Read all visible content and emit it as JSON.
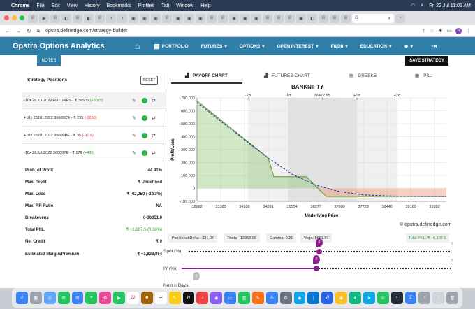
{
  "menubar": {
    "app": "Chrome",
    "items": [
      "File",
      "Edit",
      "View",
      "History",
      "Bookmarks",
      "Profiles",
      "Tab",
      "Window",
      "Help"
    ],
    "datetime": "Fri 22 Jul  11:05 AM"
  },
  "browser": {
    "url": "opstra.definedge.com/strategy-builder",
    "active_tab_icon": "G"
  },
  "app": {
    "brand": "Opstra Options Analytics",
    "nav": [
      "PORTFOLIO",
      "FUTURES",
      "OPTIONS",
      "OPEN INTEREST",
      "FII/DII",
      "EDUCATION"
    ],
    "notes": "NOTES",
    "save_strategy": "SAVE STRATEGY"
  },
  "positions": {
    "title": "Strategy Positions",
    "reset": "RESET",
    "items": [
      {
        "desc": "-10x  28JUL2022  FUTURES  - ₹ 36505",
        "chg": "(+9025)",
        "dir": "pos"
      },
      {
        "desc": "+10x  28JUL2022  36600CE  - ₹ 295",
        "chg": "(-3250)",
        "dir": "neg"
      },
      {
        "desc": "+10x  28JUL2022  35000PE  - ₹ 35",
        "chg": "(-37.5)",
        "dir": "neg"
      },
      {
        "desc": "-10x  28JUL2022  36000PE  - ₹ 176",
        "chg": "(+430)",
        "dir": "pos"
      }
    ]
  },
  "stats": [
    {
      "label": "Prob. of Profit",
      "value": "44.91%"
    },
    {
      "label": "Max. Profit",
      "value": "₹ Undefined"
    },
    {
      "label": "Max. Loss",
      "value": "₹ -62,250 (-3.83%)"
    },
    {
      "label": "Max. RR Ratio",
      "value": "NA"
    },
    {
      "label": "Breakevens",
      "value": "0-36351.0"
    },
    {
      "label": "Total PNL",
      "value": "₹ +6,187.5 (0.38%)"
    },
    {
      "label": "Net Credit",
      "value": "₹ 0"
    },
    {
      "label": "Estimated Margin/Premium",
      "value": "₹ +1,623,864"
    }
  ],
  "chart_tabs": [
    "PAYOFF CHART",
    "FUTURES CHART",
    "GREEKS",
    "P&L"
  ],
  "greeks": {
    "delta": "Positional Delta: -331.07",
    "theta": "Theta: -13953.98",
    "gamma": "Gamma: 0.21",
    "vega": "Vega: 8661.97",
    "total_pnl": "Total PNL: ₹ +6,187.5"
  },
  "sliders": {
    "spot_label": "Spot (%):",
    "iv_label": "IV (%):",
    "days_label": "Next n Days:",
    "spot_value": "0",
    "iv_value": "0",
    "days_value": "0"
  },
  "watermark": "© opstra.definedge.com",
  "colors": {
    "nav": "#2e7ea8",
    "profit": "#2a9d2a",
    "loss": "#e04040"
  },
  "chart_data": {
    "type": "area",
    "title": "BANKNIFTY",
    "xlabel": "Underlying Price",
    "ylabel": "Profit/Loss",
    "xlim": [
      32662,
      40250
    ],
    "ylim": [
      -100000,
      700000
    ],
    "x_ticks": [
      32662,
      33385,
      34108,
      34831,
      35554,
      36277,
      37000,
      37723,
      38446,
      39169,
      39892
    ],
    "y_ticks": [
      -100000,
      0,
      100000,
      200000,
      300000,
      400000,
      500000,
      600000,
      700000
    ],
    "sigma_labels": [
      {
        "label": "-2σ",
        "x": 34215
      },
      {
        "label": "-1σ",
        "x": 35435
      },
      {
        "label": "36472.65",
        "x": 36472
      },
      {
        "label": "+1σ",
        "x": 37530
      },
      {
        "label": "+2σ",
        "x": 38750
      }
    ],
    "series": [
      {
        "style": "solid",
        "x": [
          32662,
          34831,
          35000,
          35554,
          36000,
          36277,
          36600,
          40250
        ],
        "y": [
          677000,
          235000,
          90000,
          90000,
          90000,
          17000,
          -62250,
          -62250
        ]
      },
      {
        "style": "dashed",
        "x": [
          32662,
          33385,
          34108,
          34831,
          35554,
          36277,
          37000,
          37723,
          38446,
          39169,
          40250
        ],
        "y": [
          665000,
          520000,
          375000,
          235000,
          110000,
          25000,
          -25000,
          -50000,
          -58000,
          -61000,
          -62000
        ]
      }
    ]
  }
}
